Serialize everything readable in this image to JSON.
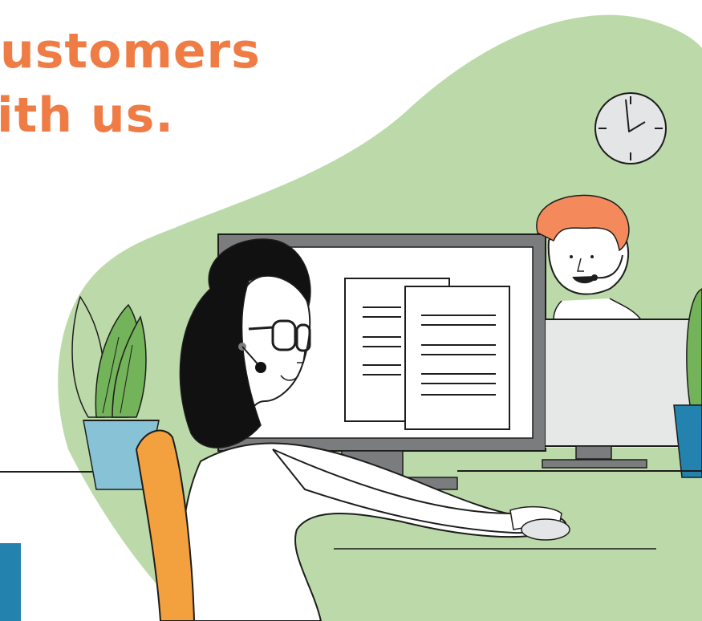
{
  "headline": {
    "line1": "ustomers",
    "line2": "ith us."
  },
  "colors": {
    "accent_orange": "#f07c45",
    "blob_green": "#bcdaa9",
    "leaf_green": "#73b359",
    "pot_blue": "#88c2d6",
    "tab_blue": "#2383ae",
    "chair_orange": "#f3a03e",
    "hair_black": "#111111",
    "agent_hair": "#f48a5c",
    "monitor_gray": "#7a7c7e",
    "outline": "#1d1d1d"
  },
  "illustration": {
    "scene": "customer-support-office",
    "icons": [
      "wall-clock-icon",
      "monitor-icon",
      "document-icon",
      "headset-icon",
      "plant-icon",
      "mouse-icon",
      "chair-icon"
    ]
  }
}
